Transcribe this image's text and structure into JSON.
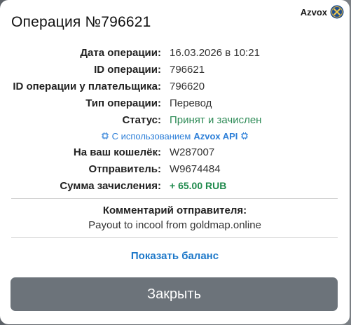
{
  "brand": {
    "name": "Azvox",
    "accent": "#1d78c9"
  },
  "title": "Операция №796621",
  "details": [
    {
      "label": "Дата операции:",
      "value": "16.03.2026 в 10:21",
      "style": "normal"
    },
    {
      "label": "ID операции:",
      "value": "796621",
      "style": "normal"
    },
    {
      "label": "ID операции у плательщика:",
      "value": "796620",
      "style": "normal"
    },
    {
      "label": "Тип операции:",
      "value": "Перевод",
      "style": "normal"
    },
    {
      "label": "Статус:",
      "value": "Принят и зачислен",
      "style": "green"
    }
  ],
  "api_note": {
    "prefix": "С использованием",
    "brand": "Azvox API",
    "icon": "chip-icon"
  },
  "details2": [
    {
      "label": "На ваш кошелёк:",
      "value": "W287007",
      "style": "normal"
    },
    {
      "label": "Отправитель:",
      "value": "W9674484",
      "style": "normal"
    },
    {
      "label": "Сумма зачисления:",
      "value": "+ 65.00 RUB",
      "style": "sum"
    }
  ],
  "comment": {
    "title": "Комментарий отправителя:",
    "text": "Payout to incool from goldmap.online"
  },
  "balance_link": "Показать баланс",
  "close_button": "Закрыть",
  "colors": {
    "status_green": "#2e8b57",
    "sum_green": "#1f8a4c",
    "link_blue": "#1d78c9",
    "button_gray": "#6c737a"
  }
}
